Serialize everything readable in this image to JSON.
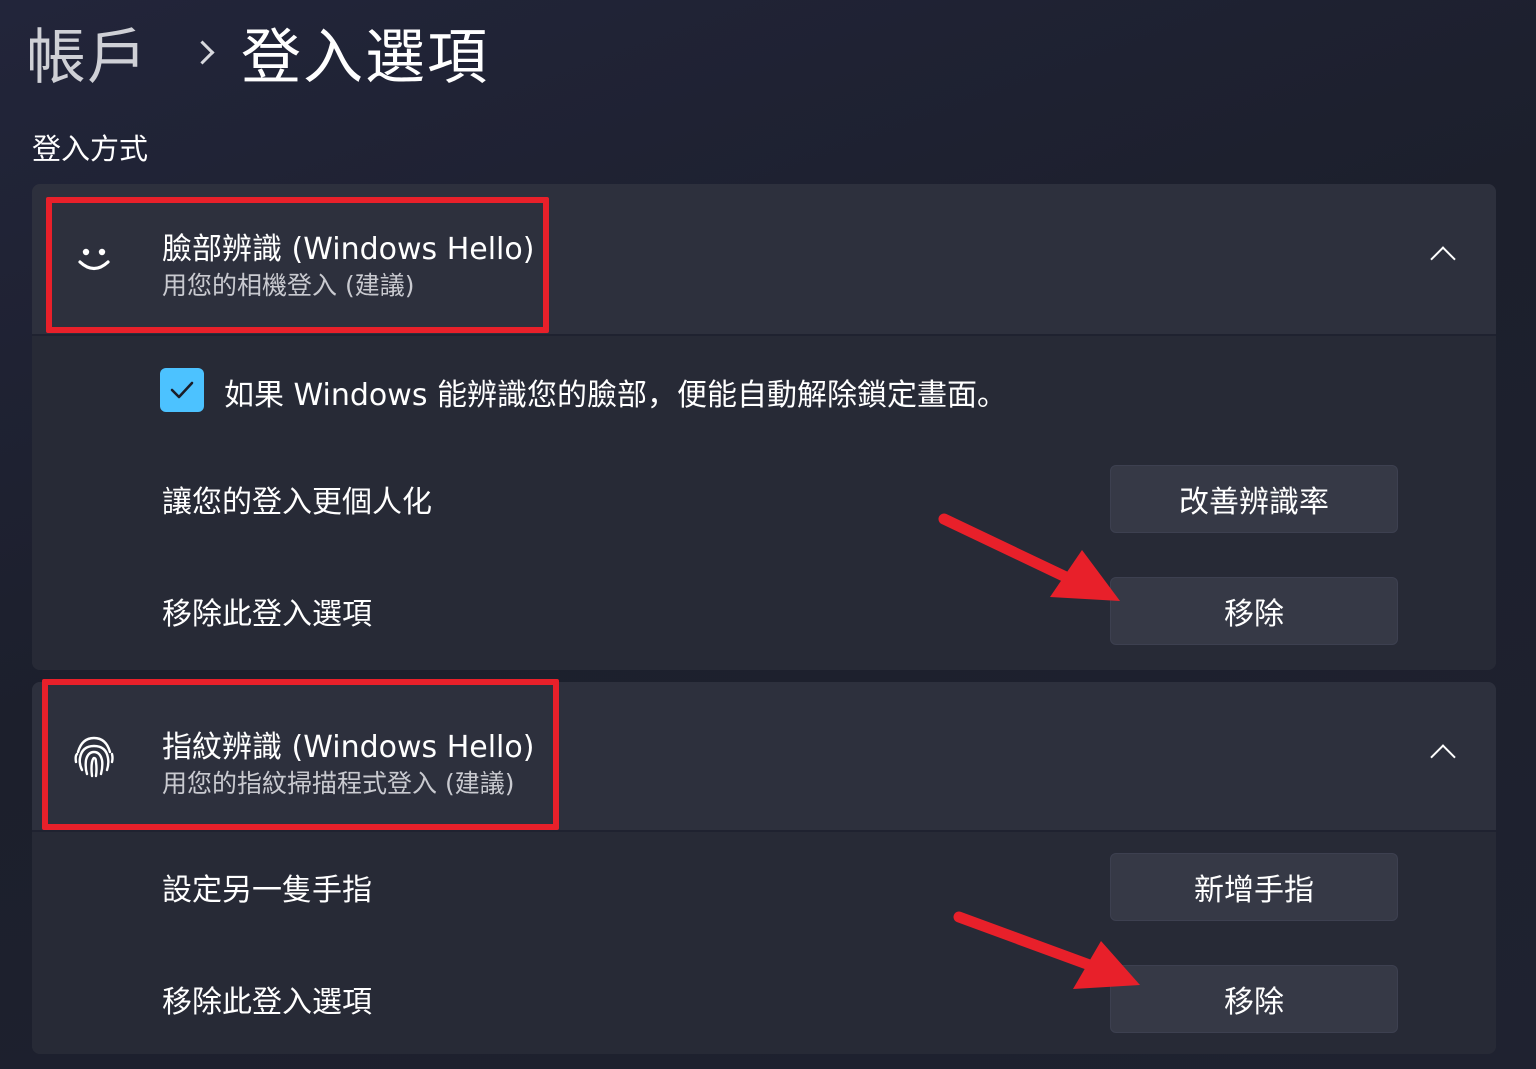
{
  "breadcrumb": {
    "parent": "帳戶",
    "current": "登入選項"
  },
  "section_title": "登入方式",
  "face": {
    "icon": "smiley-face-icon",
    "title": "臉部辨識 (Windows Hello)",
    "subtitle": "用您的相機登入 (建議)",
    "expanded": true,
    "checkbox": {
      "checked": true,
      "label": "如果 Windows 能辨識您的臉部，便能自動解除鎖定畫面。"
    },
    "rows": [
      {
        "label": "讓您的登入更個人化",
        "button": "改善辨識率"
      },
      {
        "label": "移除此登入選項",
        "button": "移除"
      }
    ]
  },
  "fingerprint": {
    "icon": "fingerprint-icon",
    "title": "指紋辨識 (Windows Hello)",
    "subtitle": "用您的指紋掃描程式登入 (建議)",
    "expanded": true,
    "rows": [
      {
        "label": "設定另一隻手指",
        "button": "新增手指"
      },
      {
        "label": "移除此登入選項",
        "button": "移除"
      }
    ]
  },
  "colors": {
    "highlight": "#e8202a",
    "accent": "#4cc2ff",
    "card": "#2b2e3b",
    "button": "#363946"
  }
}
